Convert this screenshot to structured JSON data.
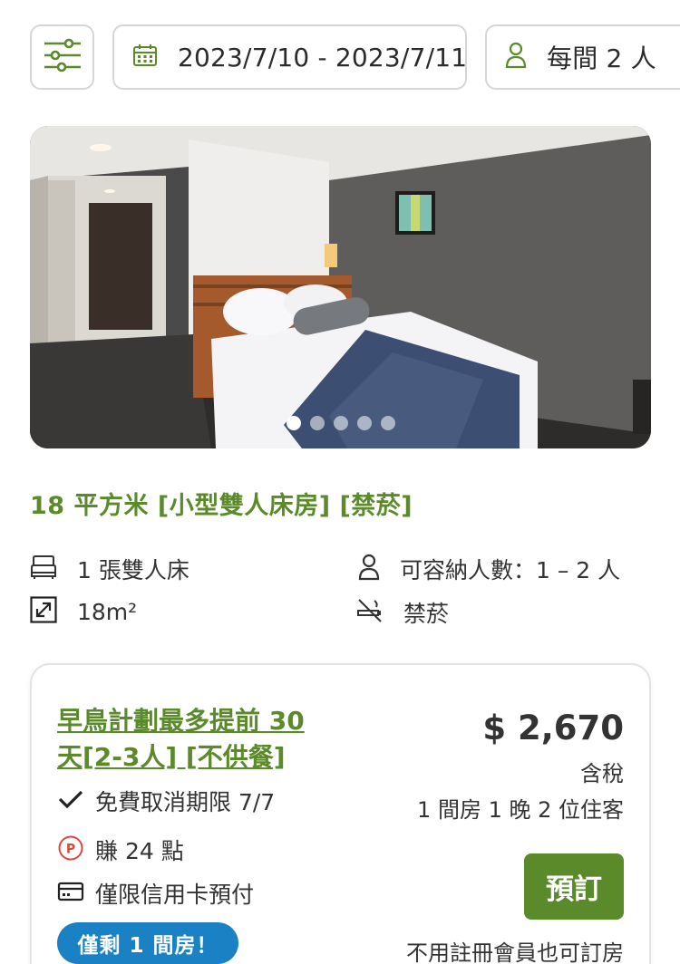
{
  "filters": {
    "filter_icon": "sliders-icon",
    "date_icon": "calendar-icon",
    "date_range": "2023/7/10 - 2023/7/11",
    "guest_icon": "person-icon",
    "guests": "每間 2 人"
  },
  "gallery": {
    "slide_count": 5,
    "active_index": 0
  },
  "room": {
    "title": "18 平方米 [小型雙人床房] [禁菸]",
    "features": {
      "bed": "1 張雙人床",
      "capacity": "可容納人數：1 – 2 人",
      "size": "18m²",
      "smoking": "禁菸"
    }
  },
  "offer": {
    "plan_line1": "早鳥計劃最多提前 30",
    "plan_line2": "天[2-3人] [不供餐]",
    "cancellation": "免費取消期限 7/7",
    "points": "賺 24 點",
    "payment": "僅限信用卡預付",
    "availability_badge": "僅剩 1 間房！",
    "price": "$ 2,670",
    "tax_note": "含稅",
    "stay_summary": "1 間房 1 晚 2 位住客",
    "book_label": "預訂",
    "no_registration": "不用註冊會員也可訂房"
  },
  "colors": {
    "brand_green": "#5a8a2a",
    "badge_blue": "#1a82c4",
    "points_red": "#d9483b"
  }
}
